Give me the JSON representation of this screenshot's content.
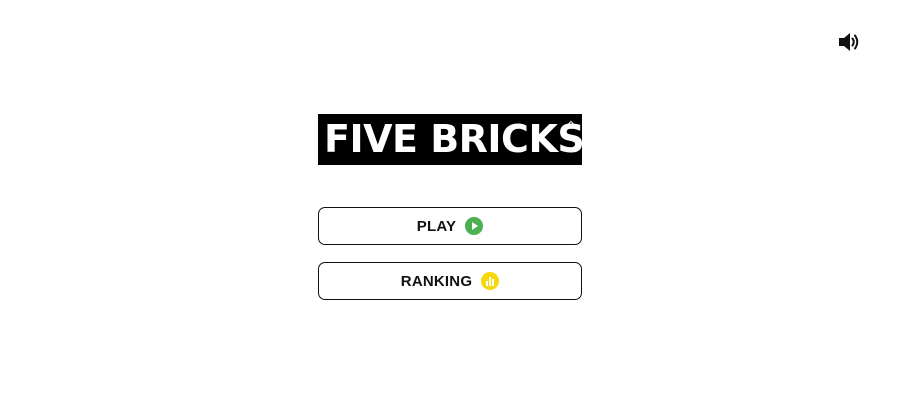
{
  "game": {
    "title": "FIVE BRICKS"
  },
  "menu": {
    "play_label": "PLAY",
    "ranking_label": "RANKING"
  },
  "icons": {
    "sound": "speaker-volume-icon",
    "play": "play-circle-icon",
    "ranking": "bar-chart-circle-icon"
  },
  "colors": {
    "background": "#ffffff",
    "logo_bg": "#000000",
    "logo_text": "#ffffff",
    "button_border": "#111111",
    "play_icon": "#4caf50",
    "ranking_icon": "#f5d90a"
  }
}
